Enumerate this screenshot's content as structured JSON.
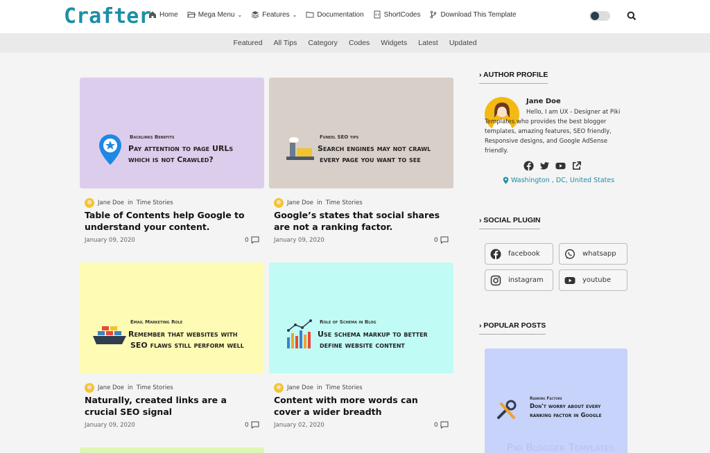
{
  "header": {
    "logo": "Crafter",
    "nav": [
      {
        "label": "Home",
        "icon": "home-icon"
      },
      {
        "label": "Mega Menu",
        "icon": "folder-open-icon",
        "dropdown": true
      },
      {
        "label": "Features",
        "icon": "layers-icon",
        "dropdown": true
      },
      {
        "label": "Documentation",
        "icon": "folder-icon"
      },
      {
        "label": "ShortCodes",
        "icon": "code-file-icon"
      },
      {
        "label": "Download This Template",
        "icon": "branch-icon"
      }
    ]
  },
  "subnav": [
    "Featured",
    "All Tips",
    "Category",
    "Codes",
    "Widgets",
    "Latest",
    "Updated"
  ],
  "posts": [
    {
      "thumb_bg": "#dccdec",
      "thumb_tag": "Backlinks Benefits",
      "thumb_line1": "Pay attention to page URLs",
      "thumb_line2": "which is not Crawled?",
      "author": "Jane Doe",
      "in": "in",
      "category": "Time Stories",
      "title": "Table of Contents help Google to understand your content.",
      "date": "January 09, 2020",
      "comments": "0"
    },
    {
      "thumb_bg": "#d8cfc8",
      "thumb_tag": "Funeel SEO tips",
      "thumb_line1": "Search engines may not crawl",
      "thumb_line2": "every page you want to see",
      "author": "Jane Doe",
      "in": "in",
      "category": "Time Stories",
      "title": "Google’s states that social shares are not a ranking factor.",
      "date": "January 09, 2020",
      "comments": "0"
    },
    {
      "thumb_bg": "#fdfbb4",
      "thumb_tag": "Email Marketing Role",
      "thumb_line1": "Remember that websites with",
      "thumb_line2": "SEO flaws still perform well",
      "author": "Jane Doe",
      "in": "in",
      "category": "Time Stories",
      "title": "Naturally, created links are a crucial SEO signal",
      "date": "January 09, 2020",
      "comments": "0"
    },
    {
      "thumb_bg": "#c1fbf5",
      "thumb_tag": "Role of Schema in Blog",
      "thumb_line1": "Use schema markup to better",
      "thumb_line2": "define website content",
      "author": "Jane Doe",
      "in": "in",
      "category": "Time Stories",
      "title": "Content with more words can cover a wider breadth",
      "date": "January 02, 2020",
      "comments": "0"
    }
  ],
  "sidebar": {
    "author_heading": "AUTHOR PROFILE",
    "author_name": "Jane Doe",
    "author_bio": "Hello, I am UX - Designer at Piki Templates who provides the best blogger templates, amazing features, SEO friendly, Responsive designs, and Google AdSense friendly.",
    "location": "Washington , DC, United States",
    "social_heading": "SOCIAL PLUGIN",
    "social_buttons": [
      {
        "label": "facebook",
        "icon": "facebook-icon"
      },
      {
        "label": "whatsapp",
        "icon": "whatsapp-icon"
      },
      {
        "label": "instagram",
        "icon": "instagram-icon"
      },
      {
        "label": "youtube",
        "icon": "youtube-icon"
      }
    ],
    "popular_heading": "POPULAR POSTS",
    "popular_tag": "Ranking Factors",
    "popular_line1": "Don't worry about every",
    "popular_line2": "ranking factor in Google",
    "popular_watermark": "Piki Blogger Templates"
  },
  "colors": {
    "accent": "#1c8fa6",
    "page_bg": "#f4f4f4"
  }
}
